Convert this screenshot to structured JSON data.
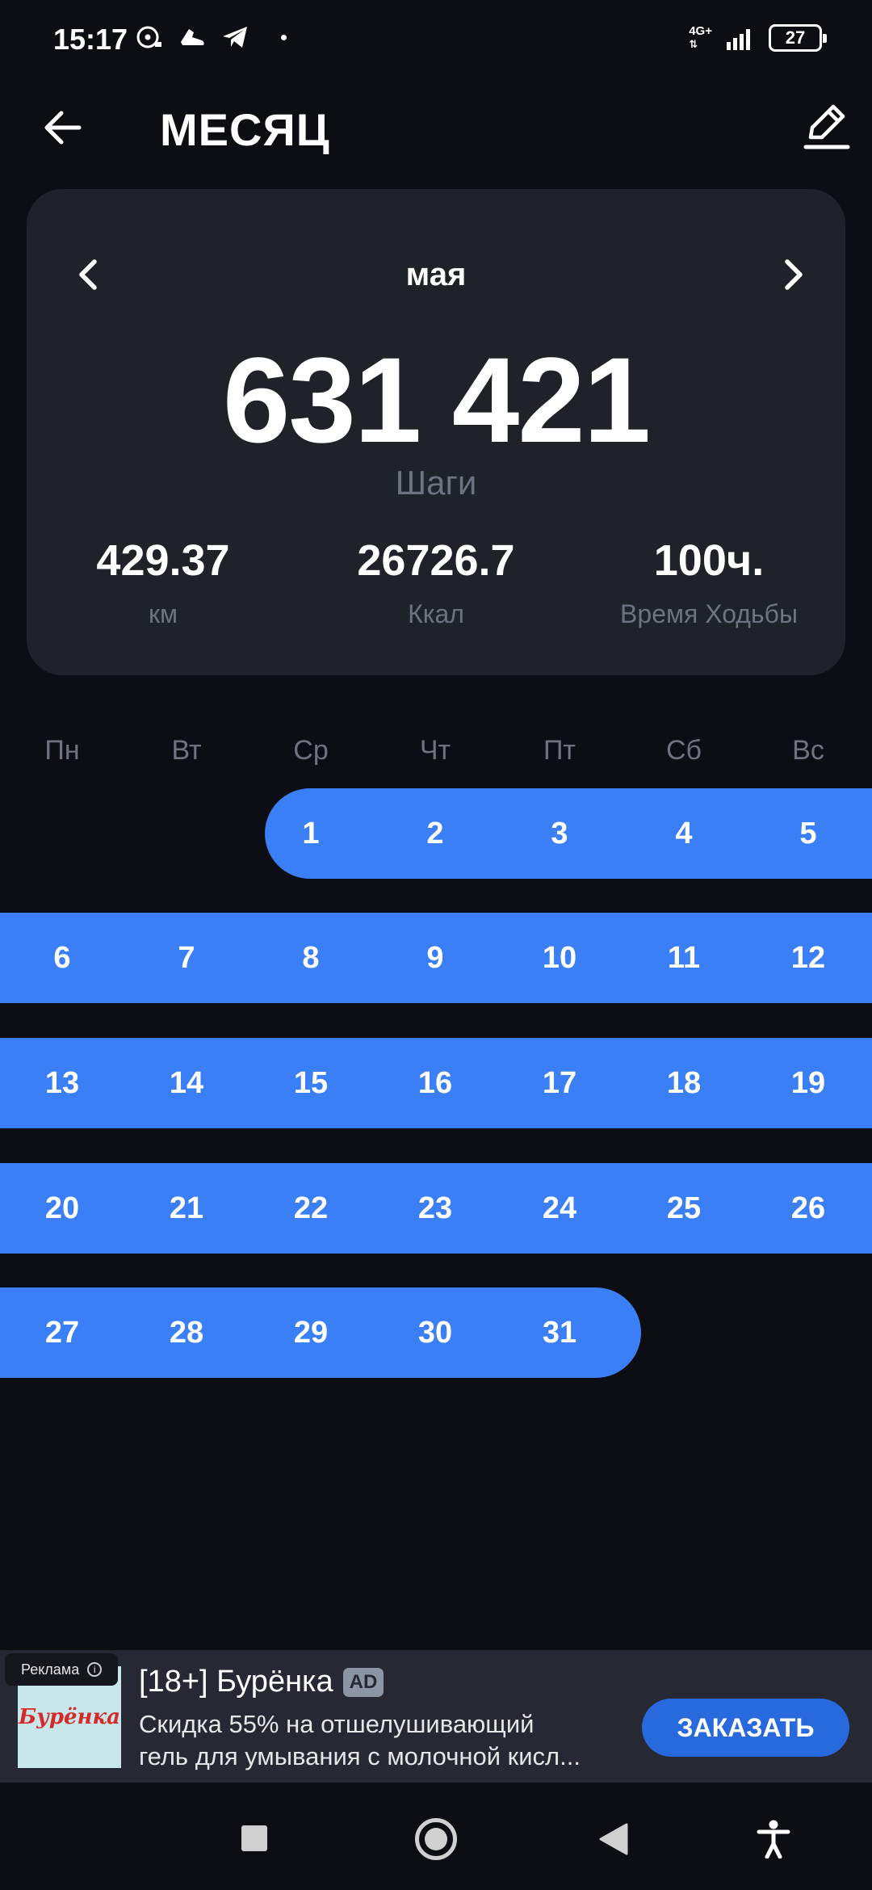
{
  "status_bar": {
    "time": "15:17",
    "network": "4G+",
    "battery": "27"
  },
  "header": {
    "title": "МЕСЯЦ"
  },
  "summary": {
    "month": "мая",
    "total_steps": "631 421",
    "total_label": "Шаги",
    "stats": [
      {
        "value": "429.37",
        "label": "км"
      },
      {
        "value": "26726.7",
        "label": "Ккал"
      },
      {
        "value": "100ч.",
        "label": "Время Ходьбы"
      }
    ]
  },
  "calendar": {
    "weekdays": [
      "Пн",
      "Вт",
      "Ср",
      "Чт",
      "Пт",
      "Сб",
      "Вс"
    ],
    "weeks": [
      [
        "",
        "",
        "1",
        "2",
        "3",
        "4",
        "5"
      ],
      [
        "6",
        "7",
        "8",
        "9",
        "10",
        "11",
        "12"
      ],
      [
        "13",
        "14",
        "15",
        "16",
        "17",
        "18",
        "19"
      ],
      [
        "20",
        "21",
        "22",
        "23",
        "24",
        "25",
        "26"
      ],
      [
        "27",
        "28",
        "29",
        "30",
        "31",
        "",
        ""
      ]
    ],
    "highlight_color": "#3a7ff5"
  },
  "ad": {
    "tag": "Реклама",
    "logo_text": "Бурёнка",
    "title": "[18+] Бурёнка",
    "badge": "AD",
    "desc_line1": "Скидка 55% на отшелушивающий",
    "desc_line2": "гель для умывания с молочной кисл...",
    "cta": "ЗАКАЗАТЬ"
  },
  "icons": {
    "back": "arrow-left-icon",
    "edit": "pencil-icon",
    "prev": "chevron-left-icon",
    "next": "chevron-right-icon"
  }
}
